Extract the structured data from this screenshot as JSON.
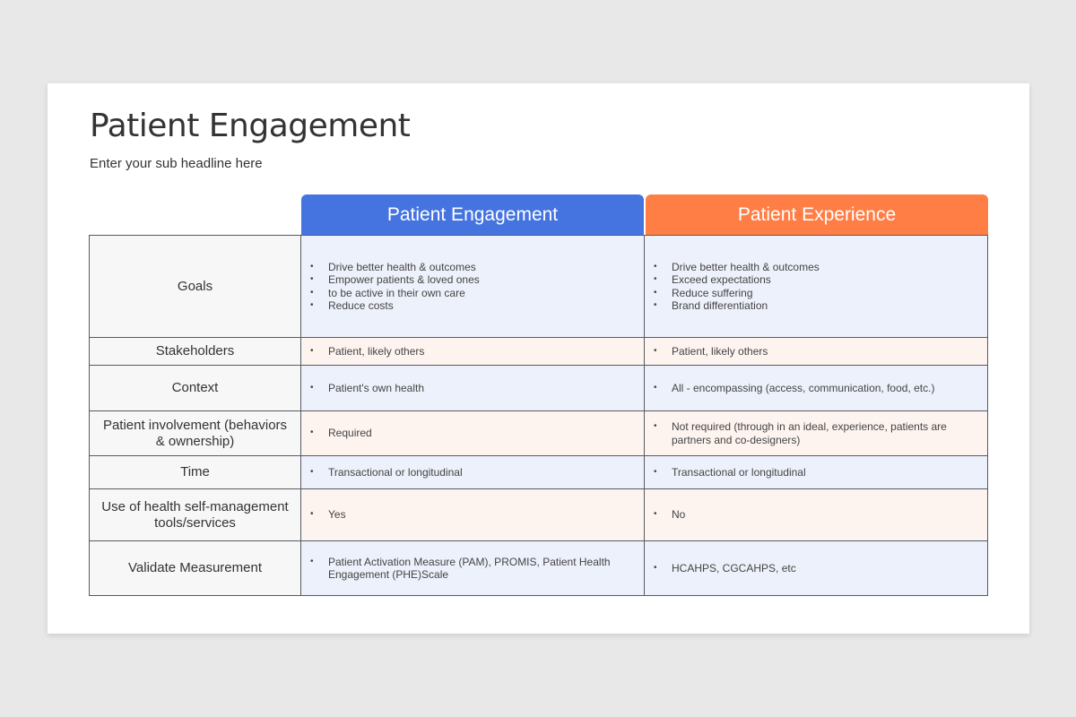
{
  "slide": {
    "title": "Patient Engagement",
    "subtitle": "Enter your sub headline here"
  },
  "columns": [
    {
      "label": "Patient Engagement",
      "color": "#4574e0"
    },
    {
      "label": "Patient Experience",
      "color": "#ff7e45"
    }
  ],
  "rows": [
    {
      "label": "Goals",
      "engagement": [
        "Drive better health & outcomes",
        "Empower patients & loved ones",
        "to be active in their own care",
        "Reduce costs"
      ],
      "experience": [
        "Drive better health & outcomes",
        "Exceed expectations",
        "Reduce suffering",
        "Brand differentiation"
      ]
    },
    {
      "label": "Stakeholders",
      "engagement": [
        "Patient, likely others"
      ],
      "experience": [
        "Patient, likely others"
      ]
    },
    {
      "label": "Context",
      "engagement": [
        "Patient's own health"
      ],
      "experience": [
        "All - encompassing (access, communication, food, etc.)"
      ]
    },
    {
      "label": "Patient involvement (behaviors & ownership)",
      "engagement": [
        "Required"
      ],
      "experience": [
        "Not required (through in an ideal, experience, patients are partners and co-designers)"
      ]
    },
    {
      "label": "Time",
      "engagement": [
        "Transactional or longitudinal"
      ],
      "experience": [
        "Transactional or longitudinal"
      ]
    },
    {
      "label": "Use of health self-management tools/services",
      "engagement": [
        "Yes"
      ],
      "experience": [
        "No"
      ]
    },
    {
      "label": "Validate Measurement",
      "engagement": [
        "Patient Activation Measure (PAM), PROMIS, Patient Health Engagement (PHE)Scale"
      ],
      "experience": [
        "HCAHPS, CGCAHPS, etc"
      ]
    }
  ]
}
